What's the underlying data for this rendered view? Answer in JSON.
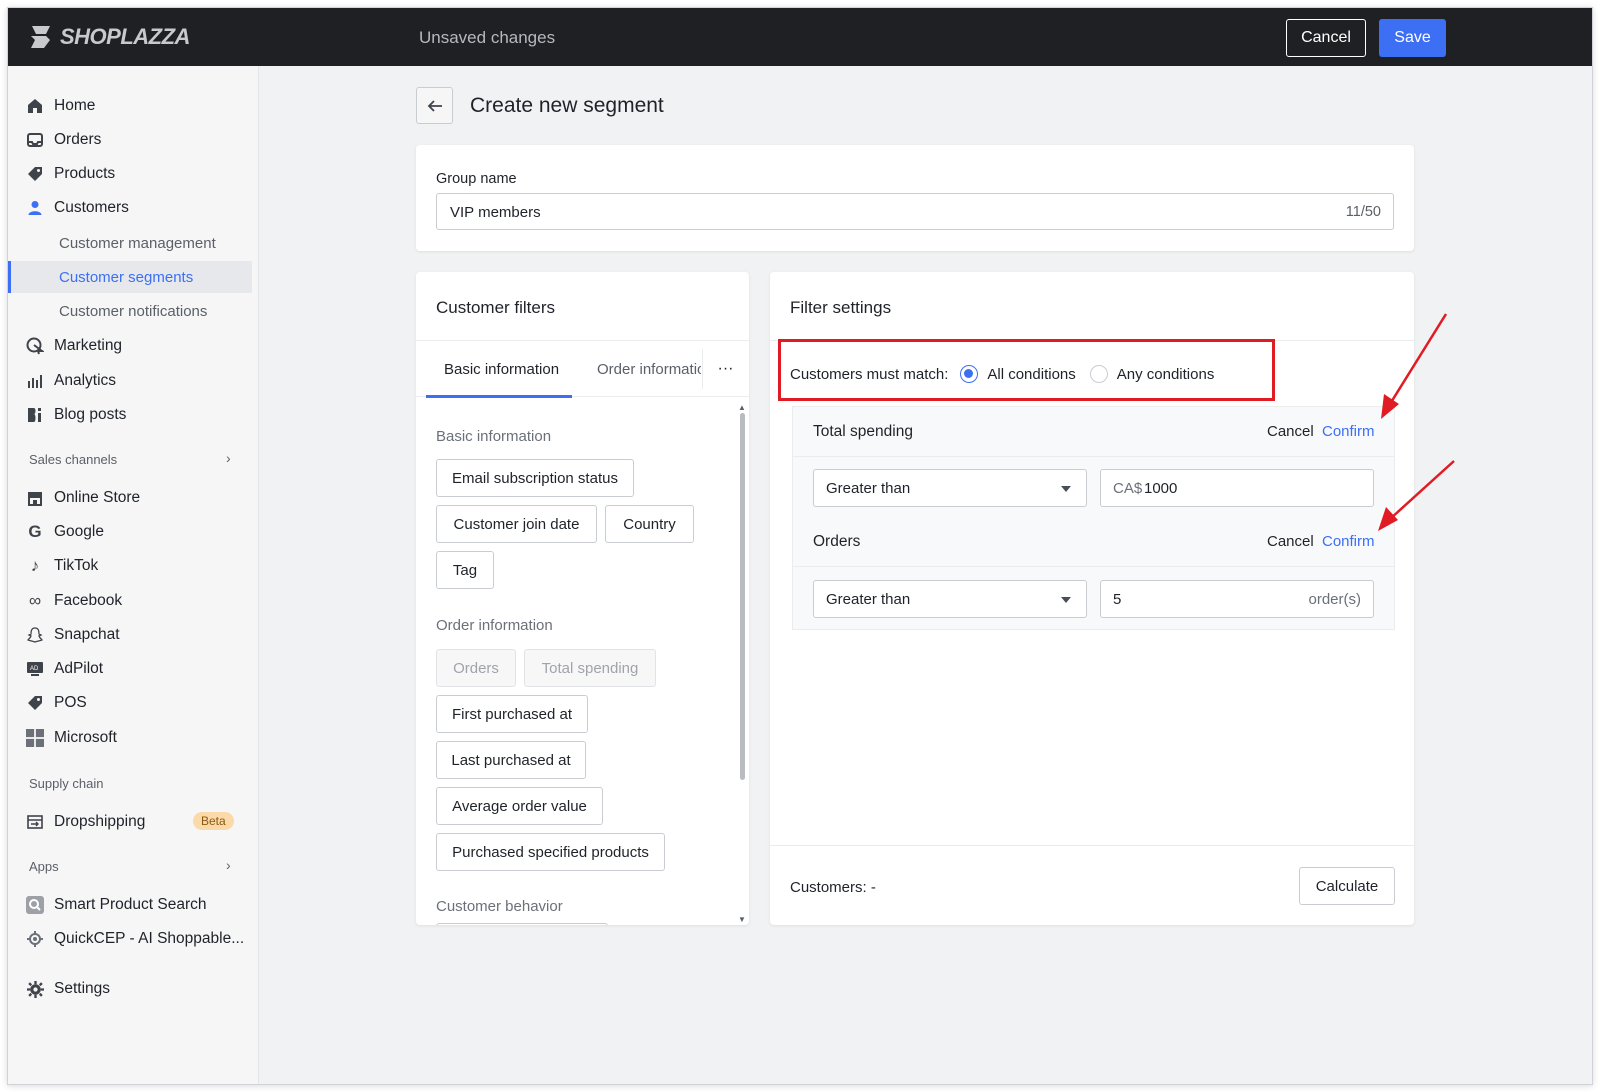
{
  "brand": {
    "name": "SHOPLAZZA"
  },
  "topbar": {
    "status": "Unsaved changes",
    "cancel_label": "Cancel",
    "save_label": "Save"
  },
  "sidebar": {
    "items": [
      {
        "label": "Home",
        "icon": "home-icon"
      },
      {
        "label": "Orders",
        "icon": "inbox-icon"
      },
      {
        "label": "Products",
        "icon": "tag-icon"
      },
      {
        "label": "Customers",
        "icon": "person-icon"
      }
    ],
    "customer_subitems": [
      {
        "label": "Customer management"
      },
      {
        "label": "Customer segments"
      },
      {
        "label": "Customer notifications"
      }
    ],
    "items2": [
      {
        "label": "Marketing",
        "icon": "marketing-icon"
      },
      {
        "label": "Analytics",
        "icon": "bar-chart-icon"
      },
      {
        "label": "Blog posts",
        "icon": "blog-icon"
      }
    ],
    "sales_channels_label": "Sales channels",
    "sales_channels": [
      {
        "label": "Online Store",
        "icon": "store-icon"
      },
      {
        "label": "Google",
        "icon": "google-icon"
      },
      {
        "label": "TikTok",
        "icon": "tiktok-icon"
      },
      {
        "label": "Facebook",
        "icon": "meta-icon"
      },
      {
        "label": "Snapchat",
        "icon": "snapchat-icon"
      },
      {
        "label": "AdPilot",
        "icon": "ad-icon"
      },
      {
        "label": "POS",
        "icon": "pos-tag-icon"
      },
      {
        "label": "Microsoft",
        "icon": "microsoft-icon"
      }
    ],
    "supply_chain_label": "Supply chain",
    "supply_chain": [
      {
        "label": "Dropshipping",
        "badge": "Beta",
        "icon": "dropship-icon"
      }
    ],
    "apps_label": "Apps",
    "apps": [
      {
        "label": "Smart Product Search",
        "icon": "search-app-icon"
      },
      {
        "label": "QuickCEP - AI Shoppable...",
        "icon": "quickcep-icon"
      }
    ],
    "settings_label": "Settings"
  },
  "page": {
    "title": "Create new segment"
  },
  "group": {
    "label": "Group name",
    "value": "VIP members",
    "counter": "11/50"
  },
  "filters": {
    "title": "Customer filters",
    "tabs": [
      "Basic information",
      "Order informatio"
    ],
    "more": "···",
    "groups": [
      {
        "heading": "Basic information",
        "chips": [
          "Email subscription status",
          "Customer join date",
          "Country",
          "Tag"
        ]
      },
      {
        "heading": "Order information",
        "chips": [
          "Orders",
          "Total spending",
          "First purchased at",
          "Last purchased at",
          "Average order value",
          "Purchased specified products"
        ]
      },
      {
        "heading": "Customer behavior",
        "chips": []
      }
    ]
  },
  "settings": {
    "title": "Filter settings",
    "match_label": "Customers must match:",
    "match_options": [
      "All conditions",
      "Any conditions"
    ],
    "match_selected": "All conditions",
    "conditions": [
      {
        "title": "Total spending",
        "cancel": "Cancel",
        "confirm": "Confirm",
        "operator": "Greater than",
        "prefix": "CA$",
        "value": "1000",
        "suffix": ""
      },
      {
        "title": "Orders",
        "cancel": "Cancel",
        "confirm": "Confirm",
        "operator": "Greater than",
        "prefix": "",
        "value": "5",
        "suffix": "order(s)"
      }
    ],
    "customers_label": "Customers: -",
    "calculate_label": "Calculate"
  },
  "colors": {
    "accent": "#3d6ff5",
    "highlight": "#e01b24",
    "topbar": "#1f2023"
  }
}
